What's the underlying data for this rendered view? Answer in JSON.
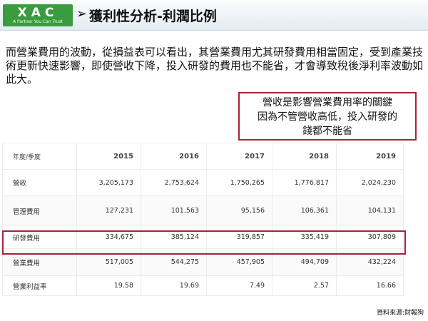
{
  "header": {
    "logo_text": "XAC",
    "logo_tagline": "A Partner You Can Trust",
    "title_arrow": "➢",
    "title": "獲利性分析-利潤比例"
  },
  "intro": {
    "text": "而營業費用的波動，從損益表可以看出，其營業費用尤其研發費用相當固定，受到產業技術更新快速影響，即使營收下降，投入研發的費用也不能省，才會導致稅後淨利率波動如此大。"
  },
  "callout": {
    "lines": [
      "營收是影響營業費用率的關鍵",
      "因為不管營收高低，投入研發的",
      "錢都不能省"
    ]
  },
  "table": {
    "header_label": "年度/季度",
    "years": [
      "2015",
      "2016",
      "2017",
      "2018",
      "2019"
    ],
    "rows": [
      {
        "label": "營收",
        "values": [
          "3,205,173",
          "2,753,624",
          "1,750,265",
          "1,776,817",
          "2,024,230"
        ]
      },
      {
        "label": "管理費用",
        "values": [
          "127,231",
          "101,563",
          "95,156",
          "106,361",
          "104,131"
        ]
      },
      {
        "label": "研發費用",
        "values": [
          "334,675",
          "385,124",
          "319,857",
          "335,419",
          "307,809"
        ]
      },
      {
        "label": "營業費用",
        "values": [
          "517,005",
          "544,275",
          "457,905",
          "494,709",
          "432,224"
        ]
      },
      {
        "label": "營業利益率",
        "values": [
          "19.58",
          "19.69",
          "7.49",
          "2.57",
          "16.66"
        ]
      }
    ]
  },
  "source": "資料來源:財報狗",
  "colors": {
    "logo_green": "#3a9b3f",
    "highlight_red": "#a6233a"
  }
}
